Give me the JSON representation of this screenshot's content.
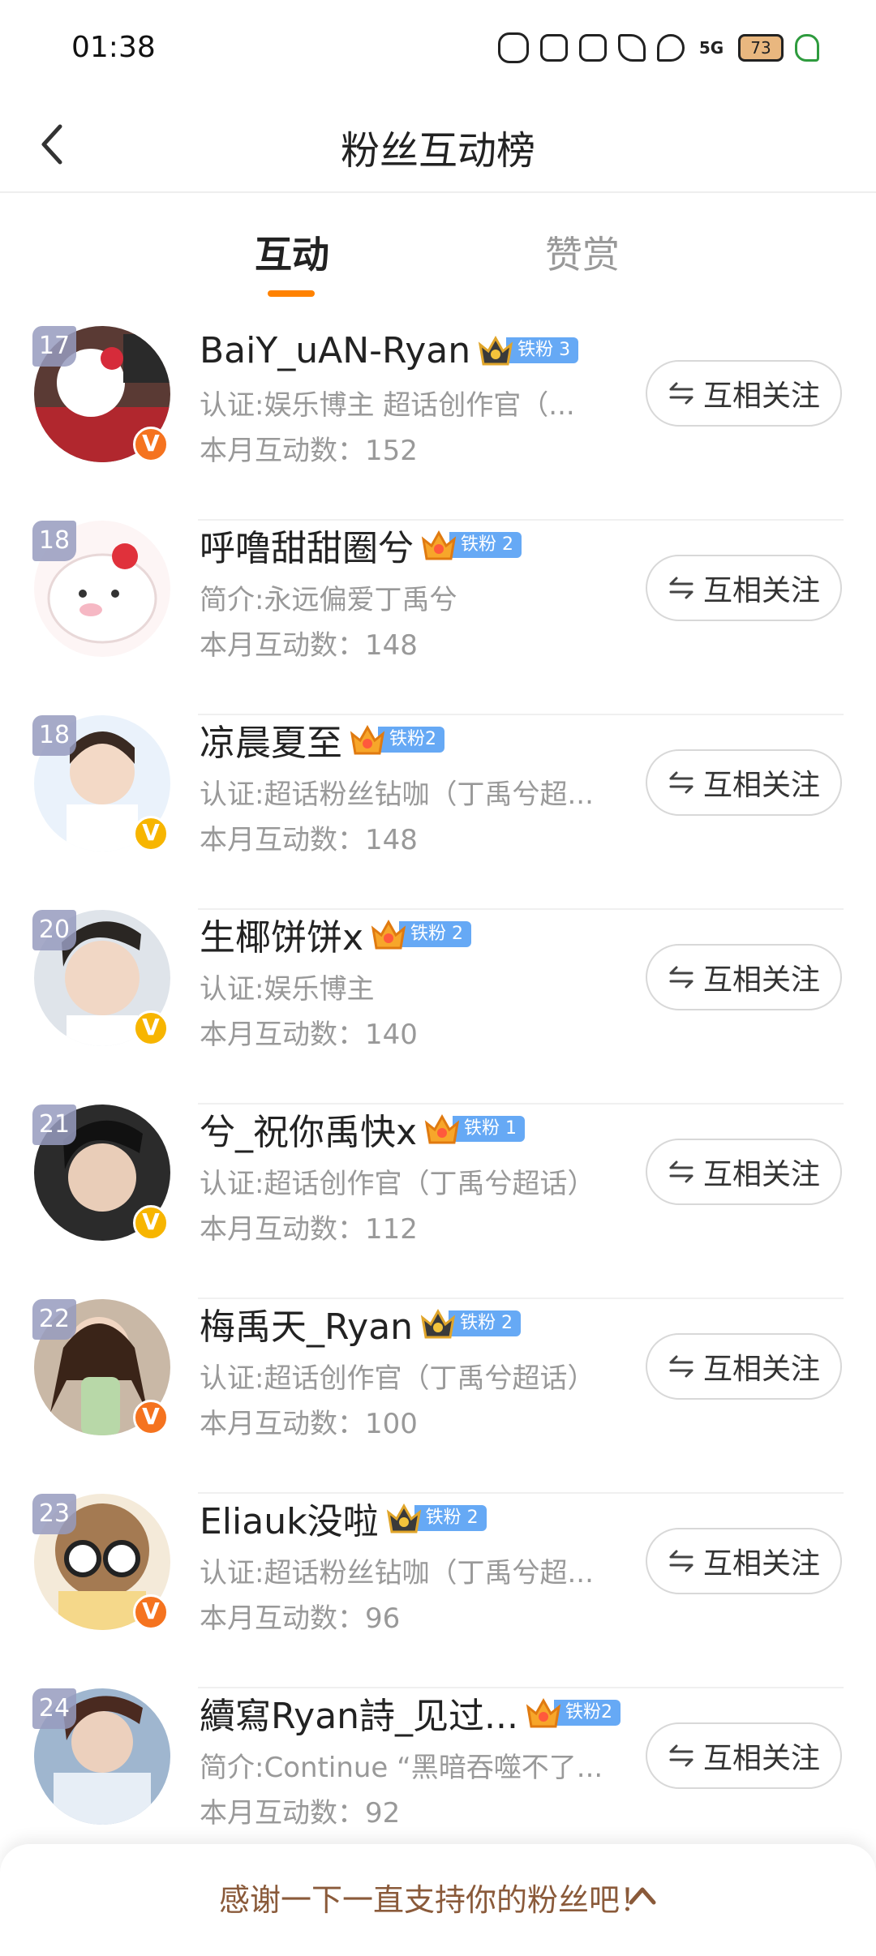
{
  "status_bar": {
    "time": "01:38",
    "network": "5G",
    "battery": "73",
    "icons": [
      "bear-icon",
      "cat-icon",
      "bunny-icon",
      "bow-icon",
      "strawberry-icon",
      "signal-icon",
      "battery-icon",
      "leaf-icon"
    ]
  },
  "header": {
    "title": "粉丝互动榜",
    "back_icon": "chevron-left-icon"
  },
  "tabs": [
    {
      "label": "互动",
      "active": true
    },
    {
      "label": "赞赏",
      "active": false
    }
  ],
  "accent_color": "#ff8200",
  "fans": [
    {
      "rank": "17",
      "name": "BaiY_uAN-Ryan",
      "fan_level": "铁粉 3",
      "crown": "dark",
      "desc": "认证:娱乐博主 超话创作官（...",
      "count": "本月互动数：152",
      "verified": "orange",
      "follow": "互相关注"
    },
    {
      "rank": "18",
      "name": "呼噜甜甜圈兮",
      "fan_level": "铁粉 2",
      "crown": "orange",
      "desc": "简介:永远偏爱丁禹兮",
      "count": "本月互动数：148",
      "verified": "",
      "follow": "互相关注"
    },
    {
      "rank": "18",
      "name": "凉晨夏至",
      "fan_level": "铁粉2",
      "crown": "orange",
      "desc": "认证:超话粉丝钻咖（丁禹兮超...",
      "count": "本月互动数：148",
      "verified": "yellow",
      "follow": "互相关注"
    },
    {
      "rank": "20",
      "name": "生椰饼饼x",
      "fan_level": "铁粉 2",
      "crown": "orange",
      "desc": "认证:娱乐博主",
      "count": "本月互动数：140",
      "verified": "yellow",
      "follow": "互相关注"
    },
    {
      "rank": "21",
      "name": "兮_祝你禹快x",
      "fan_level": "铁粉 1",
      "crown": "orange",
      "desc": "认证:超话创作官（丁禹兮超话）",
      "count": "本月互动数：112",
      "verified": "yellow",
      "follow": "互相关注"
    },
    {
      "rank": "22",
      "name": "梅禹天_Ryan",
      "fan_level": "铁粉 2",
      "crown": "dark",
      "desc": "认证:超话创作官（丁禹兮超话）",
      "count": "本月互动数：100",
      "verified": "orange",
      "follow": "互相关注"
    },
    {
      "rank": "23",
      "name": "Eliauk没啦",
      "fan_level": "铁粉 2",
      "crown": "dark",
      "desc": "认证:超话粉丝钻咖（丁禹兮超...",
      "count": "本月互动数：96",
      "verified": "orange",
      "follow": "互相关注"
    },
    {
      "rank": "24",
      "name": "續寫Ryan詩_见过...",
      "fan_level": "铁粉2",
      "crown": "orange",
      "desc": "简介:Continue “黑暗吞噬不了...",
      "count": "本月互动数：92",
      "verified": "",
      "follow": "互相关注"
    }
  ],
  "bottom_bar": {
    "text": "感谢一下一直支持你的粉丝吧！",
    "icon": "chevron-up-icon"
  }
}
